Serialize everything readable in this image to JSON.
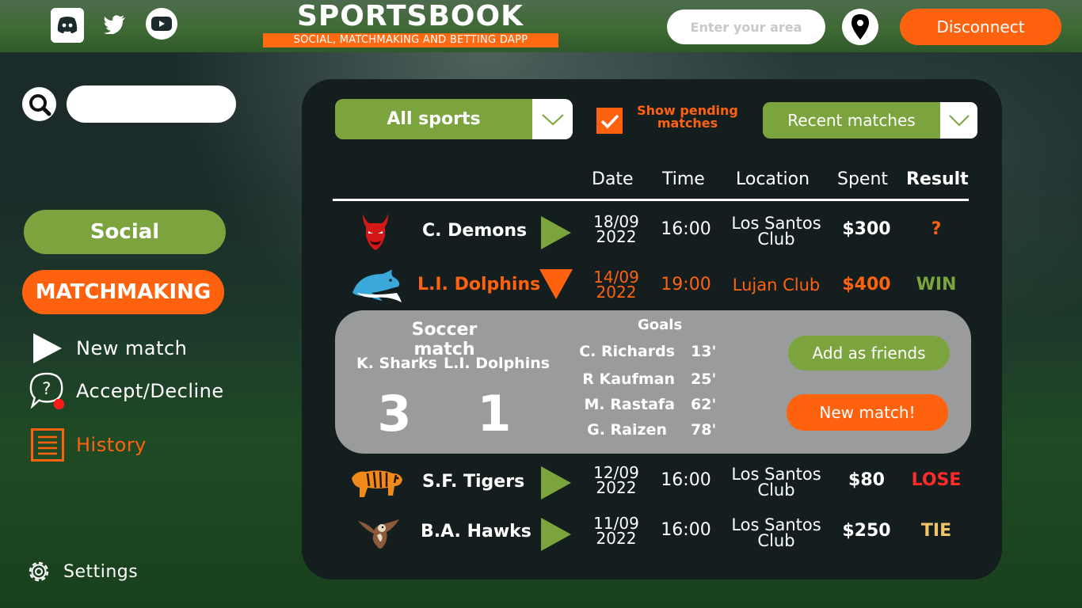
{
  "header": {
    "brand_title": "SPORTSBOOK",
    "brand_subtitle": "SOCIAL, MATCHMAKING AND BETTING DAPP",
    "area_placeholder": "Enter your area",
    "disconnect_label": "Disconnect",
    "icons": [
      "discord-icon",
      "twitter-icon",
      "youtube-icon",
      "map-pin-icon"
    ]
  },
  "sidebar": {
    "search_value": "",
    "social_label": "Social",
    "matchmaking_label": "MATCHMAKING",
    "items": [
      {
        "label": "New match",
        "icon": "play-icon"
      },
      {
        "label": "Accept/Decline",
        "icon": "question-bubble-icon"
      },
      {
        "label": "History",
        "icon": "list-icon"
      }
    ],
    "settings_label": "Settings"
  },
  "filters": {
    "sport": "All sports",
    "pending_label_line1": "Show pending",
    "pending_label_line2": "matches",
    "pending_checked": true,
    "sort": "Recent matches"
  },
  "table": {
    "headers": {
      "date": "Date",
      "time": "Time",
      "location": "Location",
      "spent": "Spent",
      "result": "Result"
    },
    "rows": [
      {
        "team": "C. Demons",
        "date_line1": "18/09",
        "date_line2": "2022",
        "time": "16:00",
        "loc_line1": "Los Santos",
        "loc_line2": "Club",
        "spent": "$300",
        "result": "?"
      },
      {
        "team": "L.I. Dolphins",
        "date_line1": "14/09",
        "date_line2": "2022",
        "time": "19:00",
        "loc_line1": "Lujan Club",
        "loc_line2": "",
        "spent": "$400",
        "result": "WIN"
      },
      {
        "team": "S.F. Tigers",
        "date_line1": "12/09",
        "date_line2": "2022",
        "time": "16:00",
        "loc_line1": "Los Santos",
        "loc_line2": "Club",
        "spent": "$80",
        "result": "LOSE"
      },
      {
        "team": "B.A. Hawks",
        "date_line1": "11/09",
        "date_line2": "2022",
        "time": "16:00",
        "loc_line1": "Los Santos",
        "loc_line2": "Club",
        "spent": "$250",
        "result": "TIE"
      }
    ]
  },
  "detail": {
    "title": "Soccer match",
    "home_team": "K. Sharks",
    "away_team": "L.I. Dolphins",
    "home_score": "3",
    "away_score": "1",
    "goals_label": "Goals",
    "goals": [
      {
        "player": "C. Richards",
        "minute": "13'"
      },
      {
        "player": "R Kaufman",
        "minute": "25'"
      },
      {
        "player": "M. Rastafa",
        "minute": "62'"
      },
      {
        "player": "G. Raizen",
        "minute": "78'"
      }
    ],
    "add_friends_label": "Add as friends",
    "new_match_label": "New match!"
  },
  "colors": {
    "accent_orange": "#ff620f",
    "accent_green": "#7ca43e",
    "lose_red": "#ff2a2a",
    "tie_tan": "#f1c36a",
    "panel_bg": "#141e1e"
  }
}
